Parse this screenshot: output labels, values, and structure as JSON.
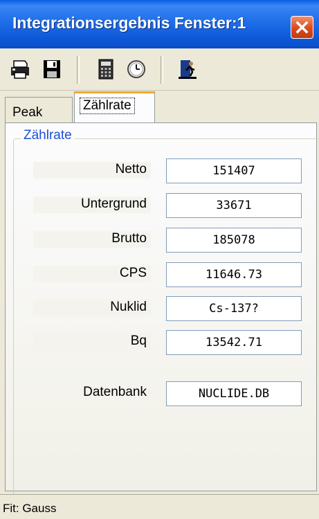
{
  "window": {
    "title": "Integrationsergebnis Fenster:1"
  },
  "toolbar": {
    "icons": [
      "printer-icon",
      "save-icon",
      "calculator-icon",
      "clock-icon",
      "exit-door-icon"
    ]
  },
  "tabs": [
    {
      "label": "Peak"
    },
    {
      "label": "Zählrate",
      "selected": true
    }
  ],
  "group": {
    "title": "Zählrate",
    "rows": [
      {
        "label": "Netto",
        "value": "151407"
      },
      {
        "label": "Untergrund",
        "value": "33671"
      },
      {
        "label": "Brutto",
        "value": "185078"
      },
      {
        "label": "CPS",
        "value": "11646.73"
      },
      {
        "label": "Nuklid",
        "value": "Cs-137?"
      },
      {
        "label": "Bq",
        "value": "13542.71"
      },
      {
        "label": "Datenbank",
        "value": "NUCLIDE.DB"
      }
    ]
  },
  "status": {
    "text": "Fit: Gauss"
  },
  "colors": {
    "titlebar": "#0a5ce6",
    "group_label": "#1f4fd8",
    "close_button": "#d84a1e",
    "tab_highlight": "#f0a830"
  }
}
